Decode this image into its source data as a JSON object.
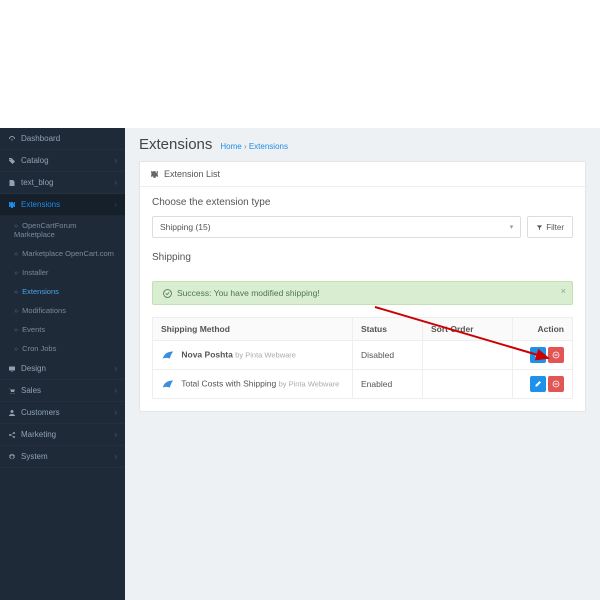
{
  "sidebar": {
    "items": [
      {
        "label": "Dashboard"
      },
      {
        "label": "Catalog"
      },
      {
        "label": "text_blog"
      },
      {
        "label": "Extensions"
      },
      {
        "label": "Design"
      },
      {
        "label": "Sales"
      },
      {
        "label": "Customers"
      },
      {
        "label": "Marketing"
      },
      {
        "label": "System"
      }
    ],
    "ext_sub": [
      {
        "label": "OpenCartForum Marketplace"
      },
      {
        "label": "Marketplace OpenCart.com"
      },
      {
        "label": "Installer"
      },
      {
        "label": "Extensions"
      },
      {
        "label": "Modifications"
      },
      {
        "label": "Events"
      },
      {
        "label": "Cron Jobs"
      }
    ]
  },
  "header": {
    "title": "Extensions",
    "crumb_home": "Home",
    "crumb_sep": " › ",
    "crumb_current": "Extensions"
  },
  "panel": {
    "head_label": "Extension List",
    "choose_label": "Choose the extension type",
    "select_value": "Shipping (15)",
    "filter_label": "Filter",
    "section_label": "Shipping"
  },
  "alert": {
    "text": "Success: You have modified shipping!"
  },
  "table": {
    "cols": {
      "method": "Shipping Method",
      "status": "Status",
      "sort": "Sort Order",
      "action": "Action"
    },
    "rows": [
      {
        "name": "Nova Poshta",
        "by": "by Pinta Webware",
        "status": "Disabled",
        "sort": ""
      },
      {
        "name": "Total Costs with Shipping",
        "by": "by Pinta Webware",
        "status": "Enabled",
        "sort": ""
      }
    ]
  }
}
